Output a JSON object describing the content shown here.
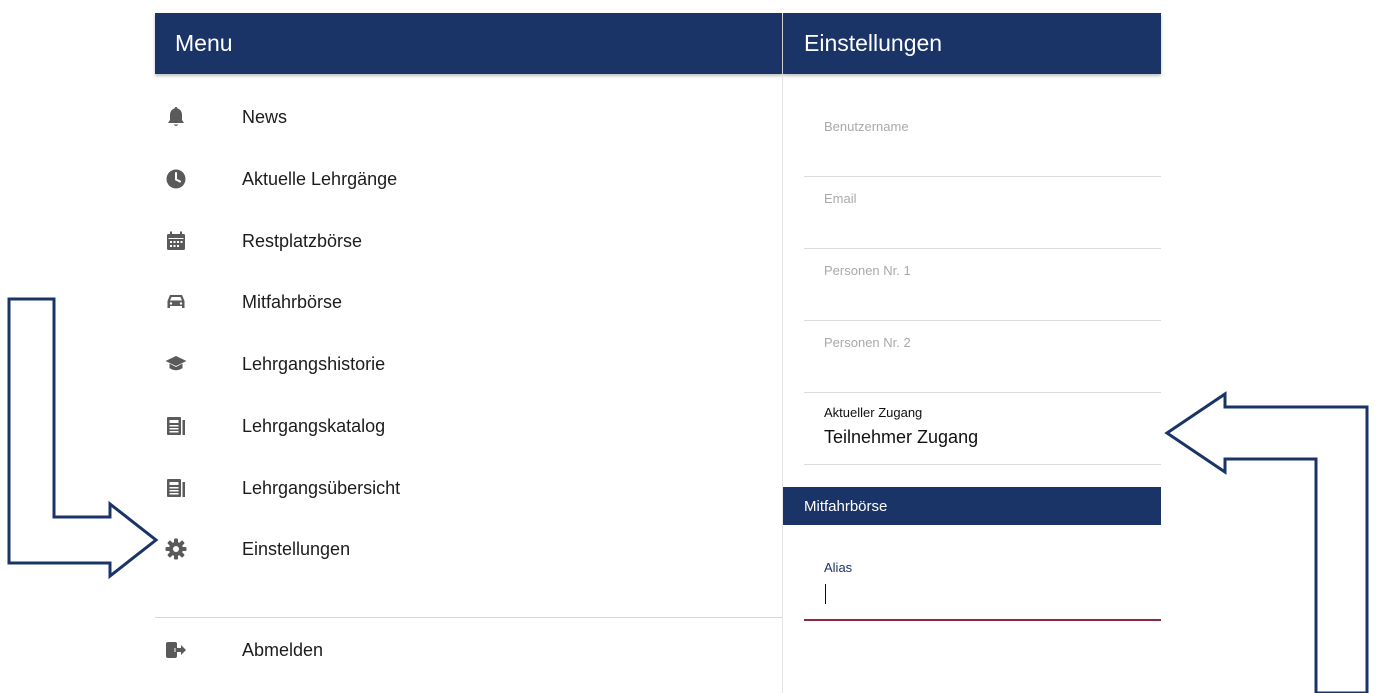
{
  "menu": {
    "title": "Menu",
    "items": [
      {
        "label": "News",
        "icon": "bell-icon"
      },
      {
        "label": "Aktuelle Lehrgänge",
        "icon": "clock-icon"
      },
      {
        "label": "Restplatzbörse",
        "icon": "calendar-icon"
      },
      {
        "label": "Mitfahrbörse",
        "icon": "car-icon"
      },
      {
        "label": "Lehrgangshistorie",
        "icon": "graduation-cap-icon"
      },
      {
        "label": "Lehrgangskatalog",
        "icon": "newspaper-icon"
      },
      {
        "label": "Lehrgangsübersicht",
        "icon": "newspaper-icon"
      },
      {
        "label": "Einstellungen",
        "icon": "gear-icon"
      }
    ],
    "logout": {
      "label": "Abmelden",
      "icon": "sign-out-icon"
    }
  },
  "settings": {
    "title": "Einstellungen",
    "fields": {
      "username": {
        "placeholder": "Benutzername",
        "value": ""
      },
      "email": {
        "placeholder": "Email",
        "value": ""
      },
      "person1": {
        "placeholder": "Personen Nr. 1",
        "value": ""
      },
      "person2": {
        "placeholder": "Personen Nr. 2",
        "value": ""
      }
    },
    "access": {
      "label": "Aktueller Zugang",
      "value": "Teilnehmer Zugang"
    },
    "section_title": "Mitfahrbörse",
    "alias": {
      "label": "Alias",
      "value": ""
    }
  },
  "colors": {
    "primary": "#1a3468",
    "icon": "#5a5a5a",
    "accent_underline": "#8b2a3f",
    "annotation_arrow": "#1a3468"
  }
}
